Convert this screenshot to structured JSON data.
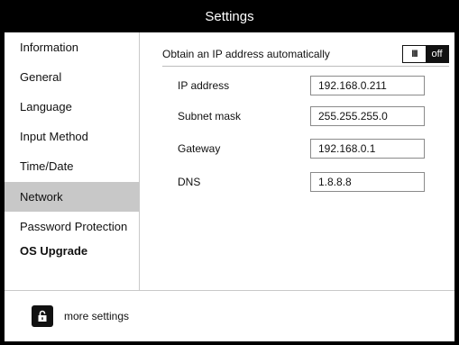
{
  "window": {
    "title": "Settings"
  },
  "sidebar": {
    "items": [
      {
        "label": "Information"
      },
      {
        "label": "General"
      },
      {
        "label": "Language"
      },
      {
        "label": "Input Method"
      },
      {
        "label": "Time/Date"
      },
      {
        "label": "Network",
        "selected": true
      },
      {
        "label": "Password Protection"
      },
      {
        "label": "OS Upgrade"
      }
    ]
  },
  "network": {
    "auto_ip_label": "Obtain an IP address automatically",
    "toggle": {
      "on_label": "III",
      "off_label": "off",
      "state": "off"
    },
    "fields": [
      {
        "label": "IP address",
        "value": "192.168.0.211"
      },
      {
        "label": "Subnet mask",
        "value": "255.255.255.0"
      },
      {
        "label": "Gateway",
        "value": "192.168.0.1"
      },
      {
        "label": "DNS",
        "value": "1.8.8.8"
      }
    ]
  },
  "footer": {
    "more_settings_label": "more settings",
    "icon": "lock-open-icon"
  },
  "colors": {
    "selected_bg": "#c8c8c8",
    "frame": "#000000",
    "toggle_off_bg": "#111111"
  }
}
